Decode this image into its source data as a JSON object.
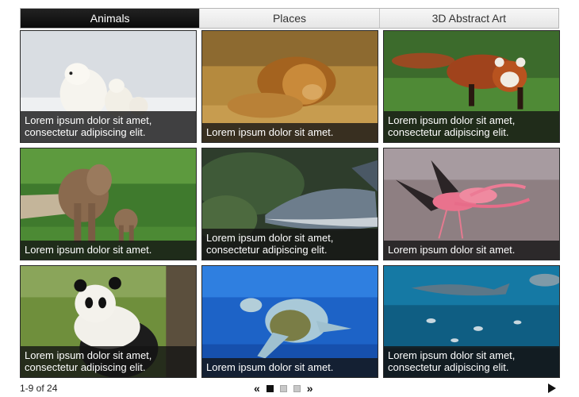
{
  "tabs": [
    {
      "label": "Animals",
      "active": true
    },
    {
      "label": "Places",
      "active": false
    },
    {
      "label": "3D Abstract Art",
      "active": false
    }
  ],
  "tiles": [
    {
      "caption": "Lorem ipsum dolor sit amet, consectetur adipiscing elit.",
      "image": "polar-bears"
    },
    {
      "caption": "Lorem ipsum dolor sit amet.",
      "image": "lion"
    },
    {
      "caption": "Lorem ipsum dolor sit amet, consectetur adipiscing elit.",
      "image": "red-panda"
    },
    {
      "caption": "Lorem ipsum dolor sit amet.",
      "image": "elephants"
    },
    {
      "caption": "Lorem ipsum dolor sit amet, consectetur adipiscing elit.",
      "image": "catfish"
    },
    {
      "caption": "Lorem ipsum dolor sit amet.",
      "image": "flamingos"
    },
    {
      "caption": "Lorem ipsum dolor sit amet, consectetur adipiscing elit.",
      "image": "panda"
    },
    {
      "caption": "Lorem ipsum dolor sit amet.",
      "image": "sea-turtle"
    },
    {
      "caption": "Lorem ipsum dolor sit amet, consectetur adipiscing elit.",
      "image": "aquarium-fish"
    }
  ],
  "pager": {
    "count": "1-9 of 24",
    "prev_label": "«",
    "next_label": "»",
    "pages": 3,
    "current_page": 1
  },
  "colors": {
    "active_tab": "#111111",
    "caption_bg": "#141414"
  }
}
